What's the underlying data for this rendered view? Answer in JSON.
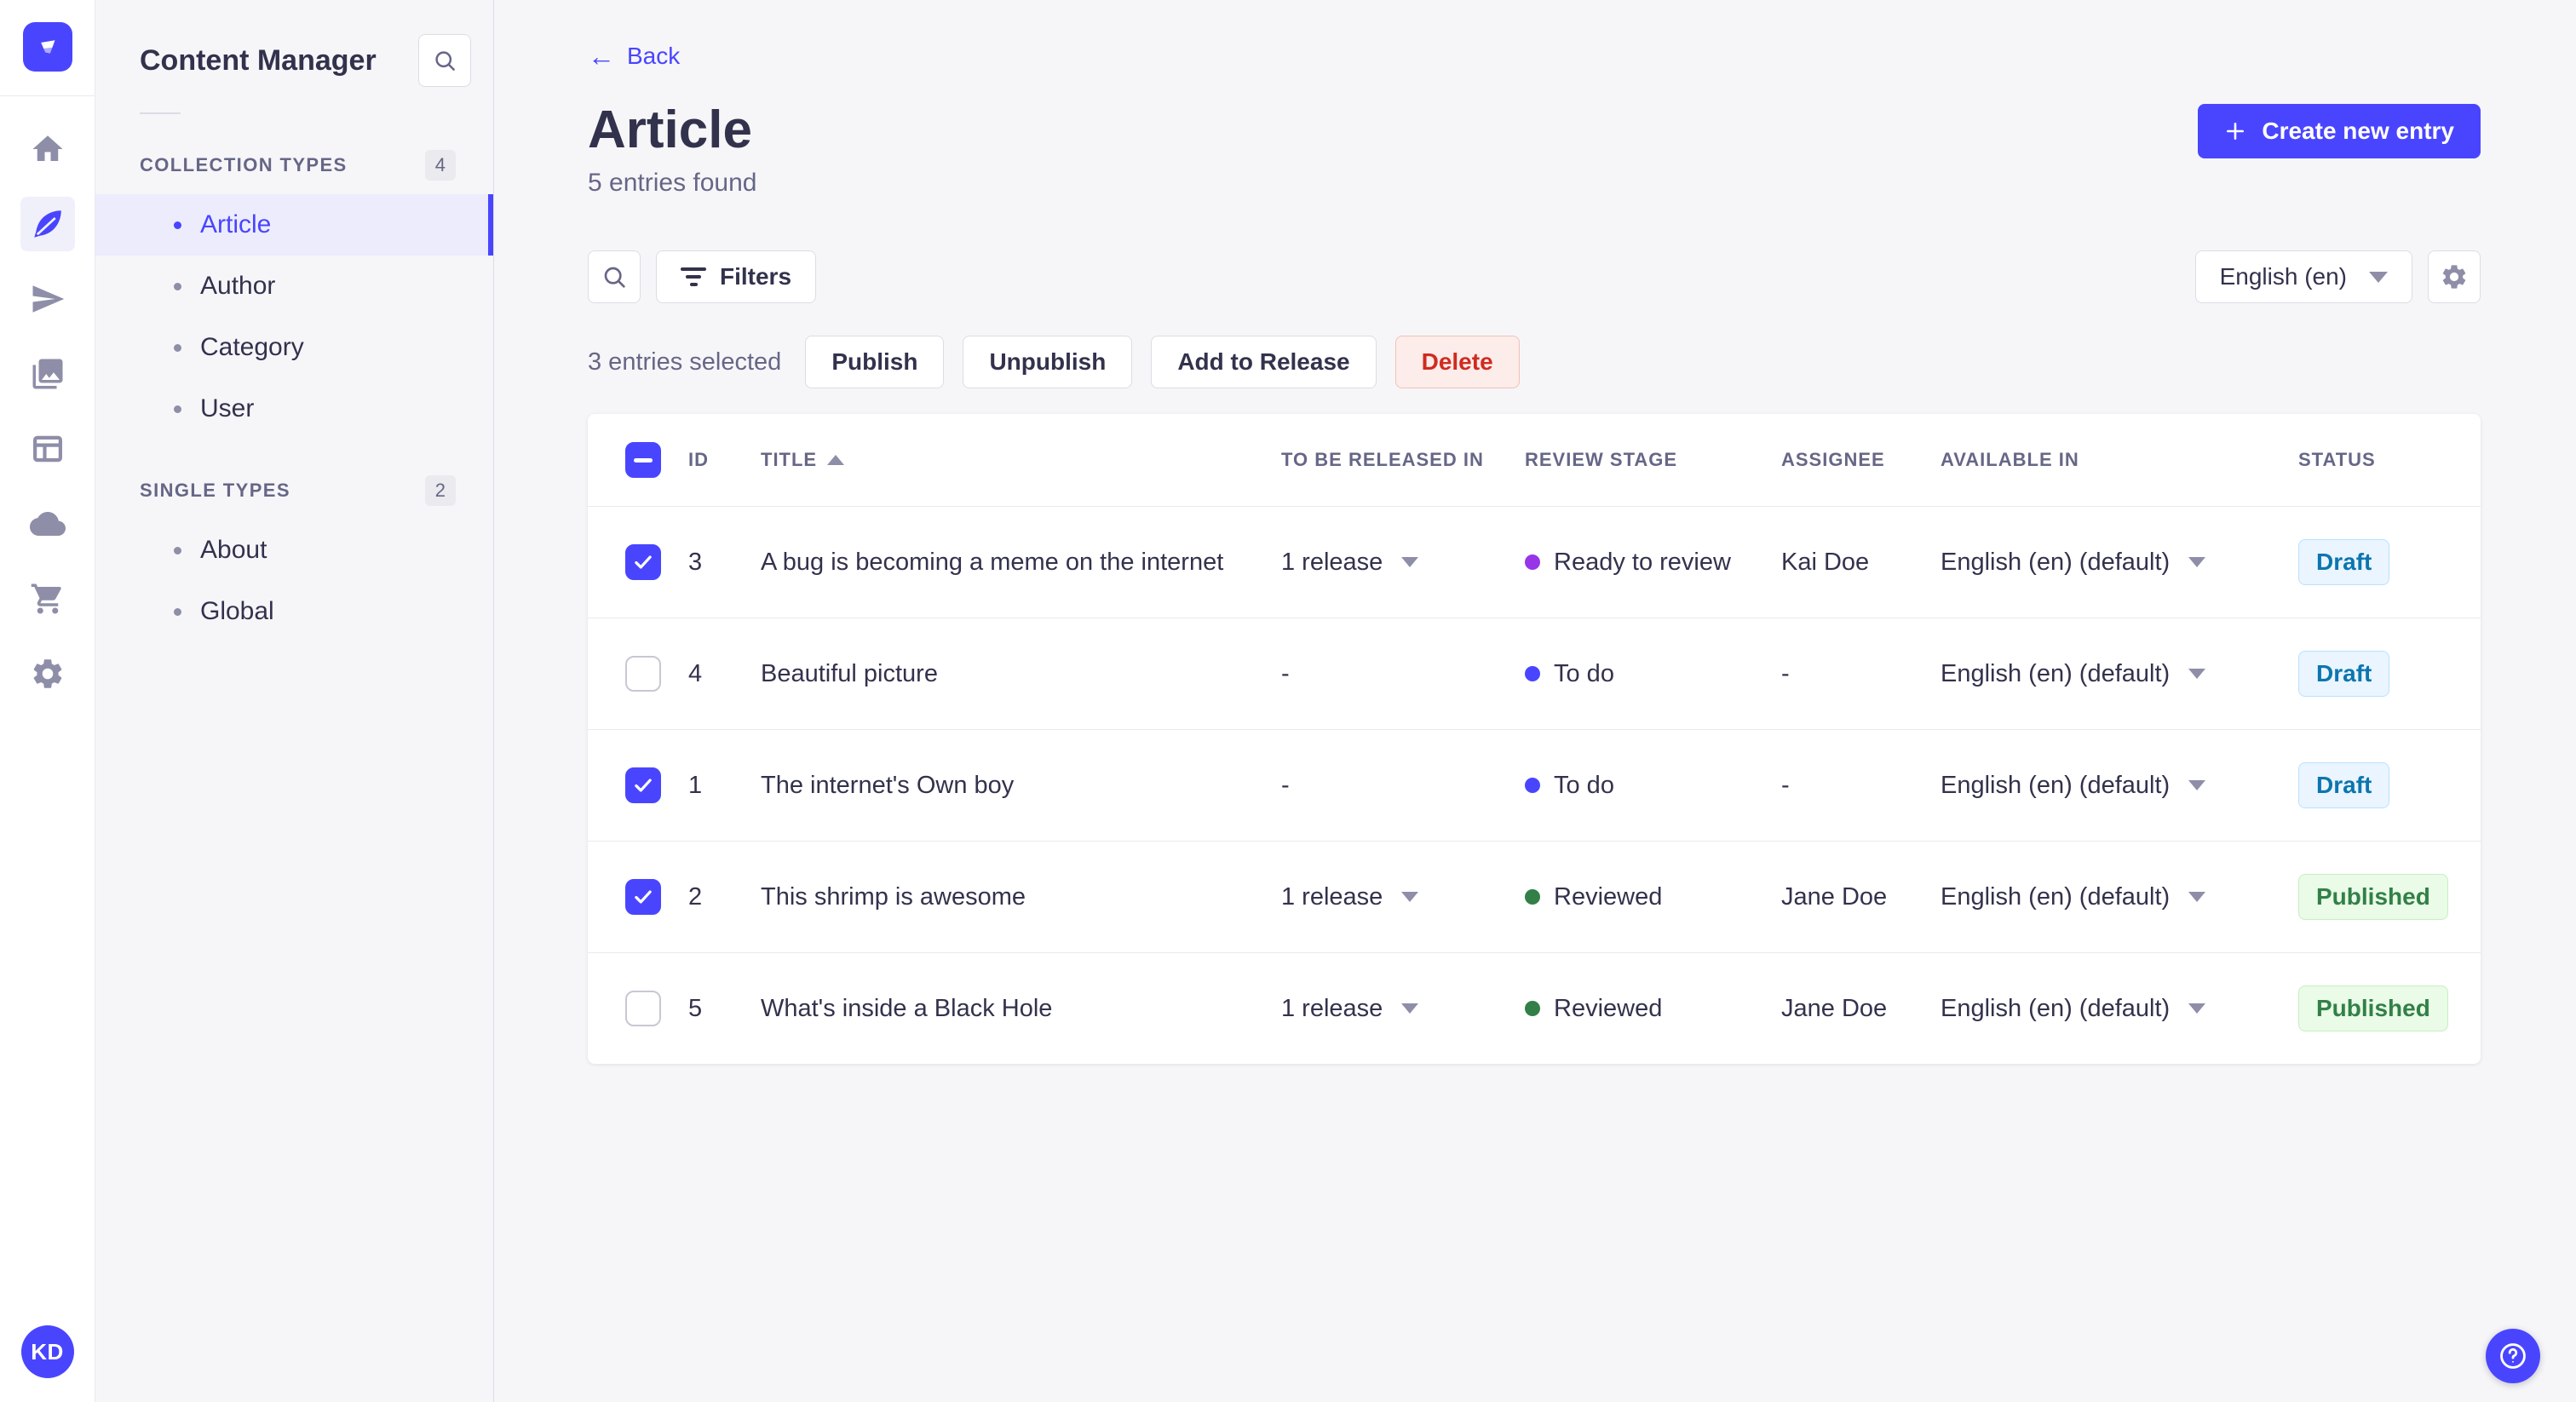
{
  "colors": {
    "primary": "#4945FF",
    "danger_text": "#D02B20",
    "danger_bg": "#FCECEA",
    "draft_text": "#0C75AF",
    "draft_bg": "#EAF5FF",
    "published_text": "#328048",
    "published_bg": "#EAFBE7"
  },
  "icon_sidebar": {
    "logo": "strapi-logo",
    "items": [
      "home",
      "content-manager-feather",
      "send-plane",
      "media-library",
      "content-type-builder",
      "cloud",
      "marketplace-cart",
      "settings-gear"
    ],
    "active_item": "content-manager-feather",
    "avatar_initials": "KD"
  },
  "sidebar": {
    "title": "Content Manager",
    "search_icon": "search-icon",
    "sections": [
      {
        "label": "COLLECTION TYPES",
        "count": "4",
        "items": [
          {
            "label": "Article",
            "active": true
          },
          {
            "label": "Author",
            "active": false
          },
          {
            "label": "Category",
            "active": false
          },
          {
            "label": "User",
            "active": false
          }
        ]
      },
      {
        "label": "SINGLE TYPES",
        "count": "2",
        "items": [
          {
            "label": "About",
            "active": false
          },
          {
            "label": "Global",
            "active": false
          }
        ]
      }
    ]
  },
  "header": {
    "back_label": "Back",
    "back_arrow": "←",
    "title": "Article",
    "subtitle": "5 entries found",
    "create_button_label": "Create new entry"
  },
  "toolbar": {
    "filters_label": "Filters",
    "locale_selected": "English (en)"
  },
  "selection": {
    "text": "3 entries selected",
    "publish_label": "Publish",
    "unpublish_label": "Unpublish",
    "add_to_release_label": "Add to Release",
    "delete_label": "Delete"
  },
  "table": {
    "header_checkbox_state": "indeterminate",
    "sorted_column": "TITLE",
    "sort_direction": "asc",
    "columns": [
      "ID",
      "TITLE",
      "TO BE RELEASED IN",
      "REVIEW STAGE",
      "ASSIGNEE",
      "AVAILABLE IN",
      "STATUS"
    ],
    "rows": [
      {
        "checked": true,
        "id": "3",
        "title": "A bug is becoming a meme on the internet",
        "release": "1 release",
        "stage": "Ready to review",
        "stage_color": "#9736E8",
        "assignee": "Kai Doe",
        "locale": "English (en) (default)",
        "status": "Draft",
        "status_variant": "b-draft"
      },
      {
        "checked": false,
        "id": "4",
        "title": "Beautiful picture",
        "release": "-",
        "stage": "To do",
        "stage_color": "#4945FF",
        "assignee": "-",
        "locale": "English (en) (default)",
        "status": "Draft",
        "status_variant": "b-draft"
      },
      {
        "checked": true,
        "id": "1",
        "title": "The internet's Own boy",
        "release": "-",
        "stage": "To do",
        "stage_color": "#4945FF",
        "assignee": "-",
        "locale": "English (en) (default)",
        "status": "Draft",
        "status_variant": "b-draft"
      },
      {
        "checked": true,
        "id": "2",
        "title": "This shrimp is awesome",
        "release": "1 release",
        "stage": "Reviewed",
        "stage_color": "#328048",
        "assignee": "Jane Doe",
        "locale": "English (en) (default)",
        "status": "Published",
        "status_variant": "b-published"
      },
      {
        "checked": false,
        "id": "5",
        "title": "What's inside a Black Hole",
        "release": "1 release",
        "stage": "Reviewed",
        "stage_color": "#328048",
        "assignee": "Jane Doe",
        "locale": "English (en) (default)",
        "status": "Published",
        "status_variant": "b-published"
      }
    ]
  },
  "help": {
    "icon": "question-mark-circle"
  }
}
